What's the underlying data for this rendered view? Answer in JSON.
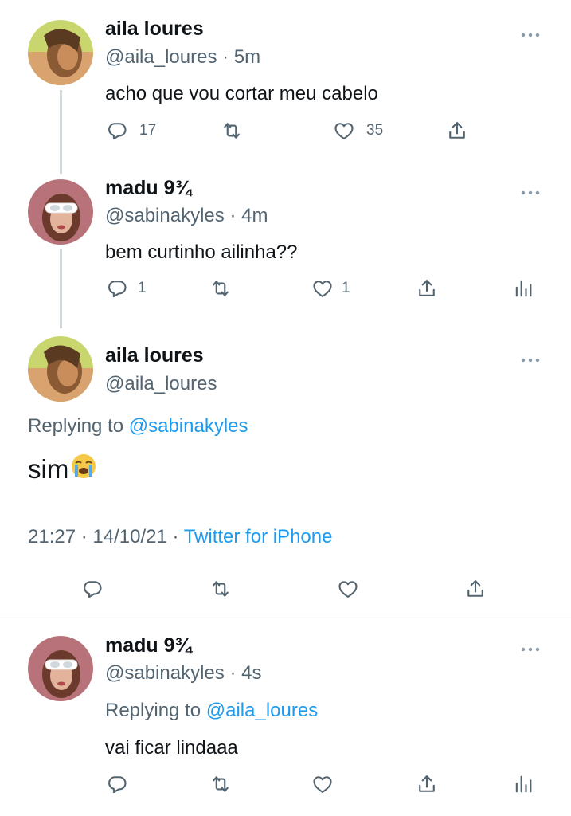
{
  "tweets": [
    {
      "name": "aila loures",
      "handle": "@aila_loures",
      "sep": "·",
      "time": "5m",
      "text": "acho que vou cortar meu cabelo",
      "reply_count": "17",
      "like_count": "35"
    },
    {
      "name": "madu 9¾",
      "handle": "@sabinakyles",
      "sep": "·",
      "time": "4m",
      "text": "bem curtinho ailinha??",
      "reply_count": "1",
      "like_count": "1"
    },
    {
      "name": "aila loures",
      "handle": "@aila_loures",
      "replying_label": "Replying to",
      "replying_handle": "@sabinakyles",
      "text": "sim",
      "emoji": "loudly-crying-face-emoji",
      "timestamp": "21:27 · 14/10/21 · ",
      "source": "Twitter for iPhone"
    },
    {
      "name": "madu 9¾",
      "handle": "@sabinakyles",
      "sep": "·",
      "time": "4s",
      "replying_label": "Replying to",
      "replying_handle": "@aila_loures",
      "text": "vai ficar lindaaa"
    }
  ],
  "icons": [
    "reply-icon",
    "retweet-icon",
    "like-icon",
    "share-icon",
    "analytics-icon",
    "more-icon"
  ],
  "colors": {
    "text": "#0f1419",
    "secondary": "#536471",
    "link": "#1d9bf0",
    "thread_line": "#cfd9de",
    "divider": "#e7e9ea"
  }
}
